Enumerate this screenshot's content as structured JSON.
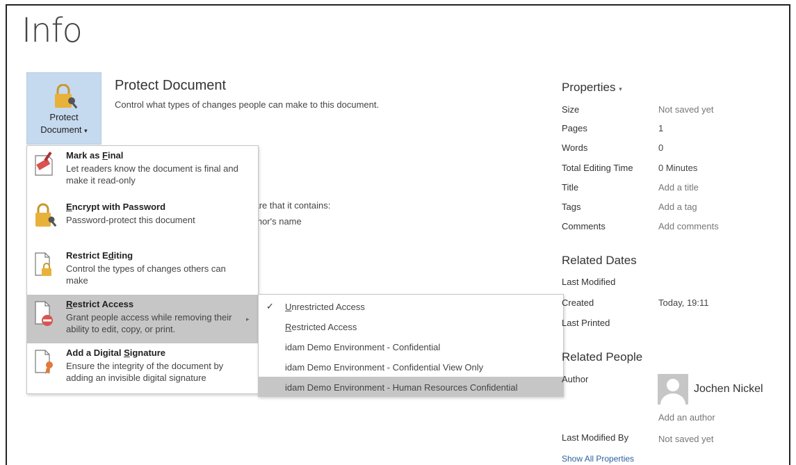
{
  "page": {
    "title": "Info"
  },
  "protect": {
    "button_line1": "Protect",
    "button_line2": "Document",
    "dropdown_glyph": "▾",
    "title": "Protect Document",
    "description": "Control what types of changes people can make to this document.",
    "behind_text_1": "vare that it contains:",
    "behind_text_2": "uthor's name"
  },
  "menu": {
    "items": [
      {
        "title_pre": "Mark as ",
        "title_ul": "F",
        "title_post": "inal",
        "desc": "Let readers know the document is final and make it read-only",
        "icon": "mark-final-icon"
      },
      {
        "title_pre": "",
        "title_ul": "E",
        "title_post": "ncrypt with Password",
        "desc": "Password-protect this document",
        "icon": "lock-key-icon"
      },
      {
        "title_pre": "Restrict E",
        "title_ul": "d",
        "title_post": "iting",
        "desc": "Control the types of changes others can make",
        "icon": "restrict-editing-icon"
      },
      {
        "title_pre": "",
        "title_ul": "R",
        "title_post": "estrict Access",
        "desc": "Grant people access while removing their ability to edit, copy, or print.",
        "icon": "restrict-access-icon",
        "arrow": "▸"
      },
      {
        "title_pre": "Add a Digital ",
        "title_ul": "S",
        "title_post": "ignature",
        "desc": "Ensure the integrity of the document by adding an invisible digital signature",
        "icon": "digital-signature-icon"
      }
    ]
  },
  "submenu": {
    "items": [
      {
        "ul": "U",
        "rest": "nrestricted Access",
        "checked": "✓"
      },
      {
        "ul": "R",
        "rest": "estricted Access"
      },
      {
        "label": "idam Demo Environment - Confidential"
      },
      {
        "label": "idam Demo Environment - Confidential View Only"
      },
      {
        "label": "idam Demo Environment - Human Resources Confidential"
      }
    ]
  },
  "properties": {
    "title": "Properties",
    "title_glyph": "▾",
    "rows": [
      {
        "label": "Size",
        "value": "Not saved yet"
      },
      {
        "label": "Pages",
        "value": "1"
      },
      {
        "label": "Words",
        "value": "0"
      },
      {
        "label": "Total Editing Time",
        "value": "0 Minutes"
      },
      {
        "label": "Title",
        "value": "Add a title"
      },
      {
        "label": "Tags",
        "value": "Add a tag"
      },
      {
        "label": "Comments",
        "value": "Add comments"
      }
    ]
  },
  "related_dates": {
    "title": "Related Dates",
    "last_modified": "Last Modified",
    "created_label": "Created",
    "created_value": "Today, 19:11",
    "last_printed": "Last Printed"
  },
  "related_people": {
    "title": "Related People",
    "author_label": "Author",
    "author_name": "Jochen Nickel",
    "add_author": "Add an author",
    "last_modified_by_label": "Last Modified By",
    "last_modified_by_value": "Not saved yet",
    "show_all": "Show All Properties"
  }
}
